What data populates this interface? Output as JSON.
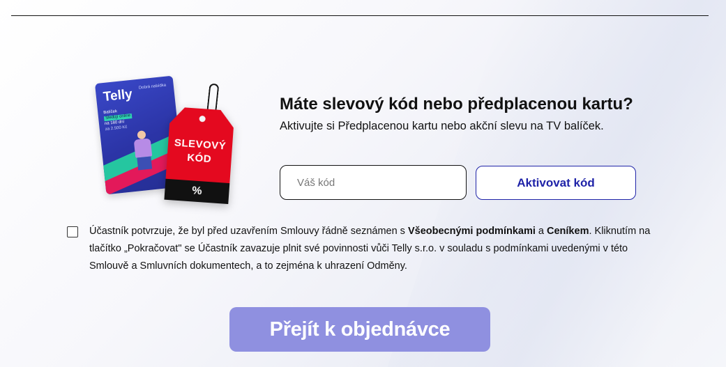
{
  "promo": {
    "card": {
      "logo": "Telly",
      "small_text": "Dobrá nabídka",
      "line1": "Balíček",
      "line2": "Sledují online",
      "line3": "na 180 dní",
      "line4": "za 2.500 Kč"
    },
    "tag": {
      "line1": "SLEVOVÝ",
      "line2": "KÓD",
      "symbol": "%"
    }
  },
  "voucher": {
    "title": "Máte slevový kód nebo předplacenou kartu?",
    "subtitle": "Aktivujte si Předplacenou kartu nebo akční slevu na TV balíček.",
    "input_placeholder": "Váš kód",
    "input_value": "",
    "activate_label": "Aktivovat kód"
  },
  "consent": {
    "checked": false,
    "text_before": "Účastník potvrzuje, že byl před uzavřením Smlouvy řádně seznámen s ",
    "terms_link": "Všeobecnými podmínkami",
    "text_and": " a ",
    "pricelist_link": "Ceníkem",
    "text_after": ". Kliknutím na tlačítko „Pokračovat\" se Účastník zavazuje plnit své povinnosti vůči Telly s.r.o. v souladu s podmínkami uvedenými v této Smlouvě a Smluvních dokumentech, a to zejména k uhrazení Odměny."
  },
  "submit": {
    "label": "Přejít k objednávce"
  },
  "colors": {
    "accent": "#1f23a8",
    "submit_bg": "#8f90e0",
    "tag_red": "#e4091f"
  }
}
